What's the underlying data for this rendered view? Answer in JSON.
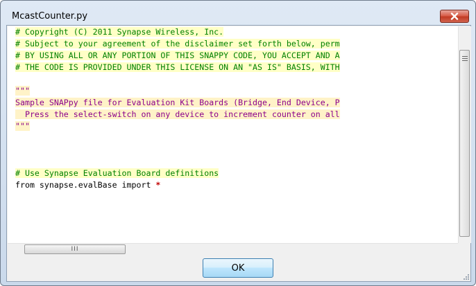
{
  "window": {
    "title": "McastCounter.py"
  },
  "editor": {
    "lines": [
      {
        "text": "# Copyright (C) 2011 Synapse Wireless, Inc.",
        "style": "comment"
      },
      {
        "text": "# Subject to your agreement of the disclaimer set forth below, perm",
        "style": "comment"
      },
      {
        "text": "# BY USING ALL OR ANY PORTION OF THIS SNAPPY CODE, YOU ACCEPT AND A",
        "style": "comment"
      },
      {
        "text": "# THE CODE IS PROVIDED UNDER THIS LICENSE ON AN \"AS IS\" BASIS, WITH",
        "style": "comment"
      },
      {
        "text": "",
        "style": "plain"
      },
      {
        "text": "\"\"\"",
        "style": "string"
      },
      {
        "text": "Sample SNAPpy file for Evaluation Kit Boards (Bridge, End Device, P",
        "style": "string"
      },
      {
        "text": "  Press the select-switch on any device to increment counter on all",
        "style": "string"
      },
      {
        "text": "\"\"\"",
        "style": "string"
      },
      {
        "text": "",
        "style": "plain"
      },
      {
        "text": "",
        "style": "plain"
      },
      {
        "text": "",
        "style": "plain"
      },
      {
        "text": "# Use Synapse Evaluation Board definitions",
        "style": "comment"
      },
      {
        "text": "from synapse.evalBase import ",
        "style": "plain",
        "suffix": "*"
      }
    ]
  },
  "buttons": {
    "ok_label": "OK",
    "close_glyph": "✕"
  },
  "scrollbar": {
    "h_thumb_grip": "III"
  },
  "colors": {
    "comment": "#008000",
    "string": "#8b008b",
    "operator": "#c00000",
    "close_button": "#c23b24"
  }
}
